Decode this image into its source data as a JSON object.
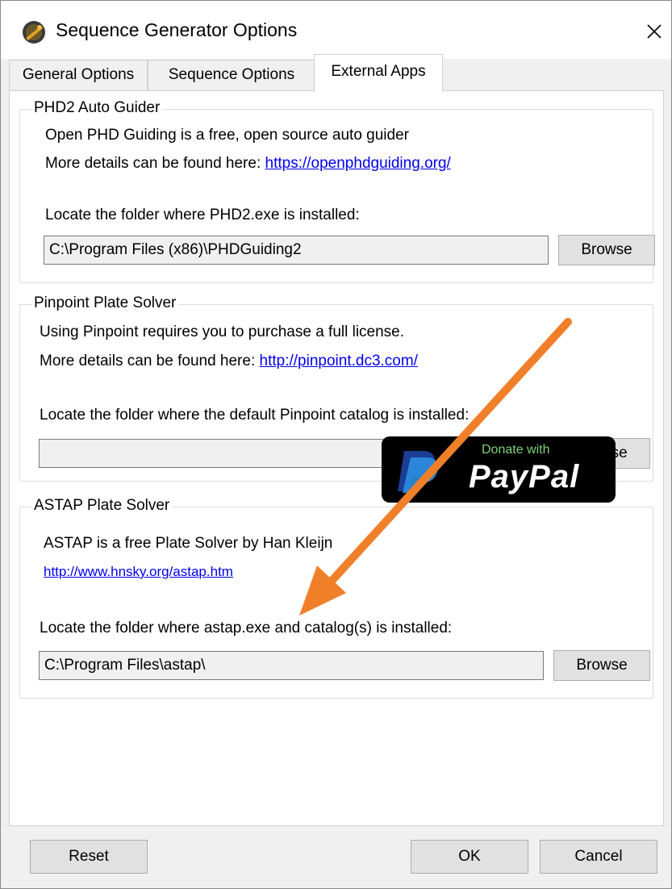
{
  "window": {
    "title": "Sequence Generator Options"
  },
  "tabs": [
    {
      "label": "General Options",
      "active": false
    },
    {
      "label": "Sequence Options",
      "active": false
    },
    {
      "label": "External Apps",
      "active": true
    }
  ],
  "phd2": {
    "group_title": "PHD2 Auto Guider",
    "description": "Open PHD Guiding is a free, open source auto guider",
    "details_prefix": "More details can be found here: ",
    "details_link": "https://openphdguiding.org/",
    "locate_label": "Locate the folder where PHD2.exe is installed:",
    "path_value": "C:\\Program Files (x86)\\PHDGuiding2",
    "browse_label": "Browse"
  },
  "pinpoint": {
    "group_title": "Pinpoint Plate Solver",
    "description": "Using Pinpoint requires you to purchase a full license.",
    "details_prefix": "More details can be found here: ",
    "details_link": "http://pinpoint.dc3.com/",
    "locate_label": "Locate the folder where the default Pinpoint catalog is installed:",
    "path_value": "",
    "browse_label": "Browse"
  },
  "astap": {
    "group_title": "ASTAP Plate Solver",
    "description": "ASTAP is a free Plate Solver by Han Kleijn",
    "link": "http://www.hnsky.org/astap.htm",
    "locate_label": "Locate the folder where astap.exe and catalog(s) is installed:",
    "path_value": "C:\\Program Files\\astap\\",
    "browse_label": "Browse",
    "donate": {
      "top_text": "Donate with",
      "brand_text": "PayPal"
    }
  },
  "footer": {
    "reset_label": "Reset",
    "ok_label": "OK",
    "cancel_label": "Cancel"
  },
  "colors": {
    "link": "#0000ee",
    "arrow": "#f07f2a",
    "paypal_bg": "#000000",
    "paypal_dark_blue": "#1b3d94",
    "paypal_light_blue": "#2d8ee0"
  },
  "icons": {
    "app": "telescope-icon",
    "close": "close-icon",
    "paypal": "paypal-logo-icon",
    "annotation": "arrow-annotation"
  }
}
